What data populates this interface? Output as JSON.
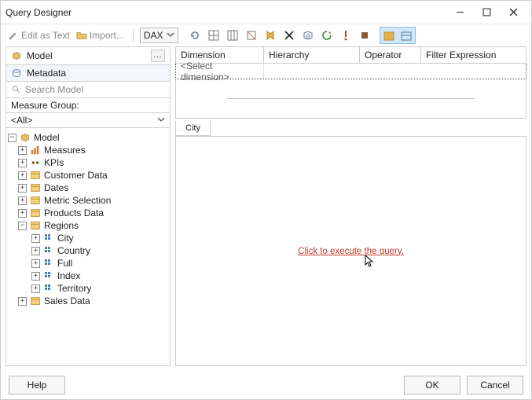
{
  "window": {
    "title": "Query Designer"
  },
  "toolbar": {
    "edit_as_text": "Edit as Text",
    "import": "Import...",
    "language": "DAX"
  },
  "left": {
    "model_header": "Model",
    "metadata": "Metadata",
    "search_placeholder": "Search Model",
    "measure_group_label": "Measure Group:",
    "measure_group_value": "<All>"
  },
  "tree": {
    "root": "Model",
    "items": [
      {
        "label": "Measures",
        "icon": "measures"
      },
      {
        "label": "KPIs",
        "icon": "kpi"
      },
      {
        "label": "Customer Data",
        "icon": "table"
      },
      {
        "label": "Dates",
        "icon": "table"
      },
      {
        "label": "Metric Selection",
        "icon": "table"
      },
      {
        "label": "Products Data",
        "icon": "table"
      }
    ],
    "regions": {
      "label": "Regions",
      "children": [
        "City",
        "Country",
        "Full",
        "Index",
        "Territory"
      ]
    },
    "sales": "Sales Data"
  },
  "grid": {
    "col_dimension": "Dimension",
    "col_hierarchy": "Hierarchy",
    "col_operator": "Operator",
    "col_filter": "Filter Expression",
    "select_dimension": "<Select dimension>"
  },
  "result": {
    "tab": "City",
    "exec_link": "Click to execute the query."
  },
  "footer": {
    "help": "Help",
    "ok": "OK",
    "cancel": "Cancel"
  }
}
